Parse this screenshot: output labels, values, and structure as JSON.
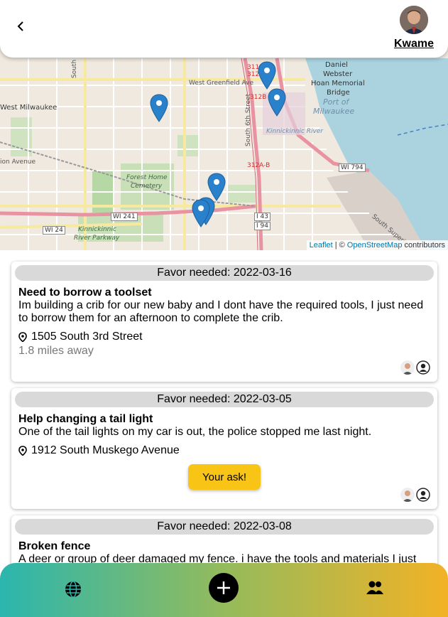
{
  "header": {
    "username": "Kwame",
    "back_icon": "chevron-left-icon",
    "avatar_icon": "user-avatar"
  },
  "map": {
    "labels": {
      "west_milwaukee": "West Milwaukee",
      "west_greenfield": "West Greenfield Ave",
      "south_35th": "South 35th Street",
      "south_6th": "South 6th Street",
      "forest_home": "Forest Home",
      "cemetery": "Cemetery",
      "kinnickinnic_parkway_1": "Kinnickinnic",
      "kinnickinnic_parkway_2": "River Parkway",
      "kinnickinnic_river": "Kinnickinnic River",
      "daniel": "Daniel",
      "webster": "Webster",
      "hoan": "Hoan Memorial",
      "bridge": "Bridge",
      "port_of": "Port of",
      "milwaukee": "Milwaukee",
      "south_superior": "South Superior Street",
      "hwy_wi794": "WI 794",
      "hwy_wi241": "WI 241",
      "hwy_wi24": "WI 24",
      "hwy_i43": "I 43",
      "hwy_i94": "I 94",
      "exit_311": "311",
      "exit_312": "312",
      "exit_312b": "312B",
      "exit_312ab": "312A-B",
      "ion_avenue": "ion Avenue"
    },
    "attribution": {
      "leaflet": "Leaflet",
      "sep": "| ©",
      "osm": "OpenStreetMap",
      "contributors": "contributors"
    },
    "marker_icon": "map-pin-icon"
  },
  "cards": [
    {
      "date": "Favor needed: 2022-03-16",
      "title": "Need to borrow a toolset",
      "description": "Im building a crib for our new baby and I dont have the required tools, I just need to borrow them for an afternoon to complete the crib.",
      "address": "1505 South 3rd Street",
      "distance": "1.8 miles away"
    },
    {
      "date": "Favor needed: 2022-03-05",
      "title": "Help changing a tail light",
      "description": "One of the tail lights on my car is out, the police stopped me last night.",
      "address": "1912 South Muskego Avenue",
      "button": "Your ask!"
    },
    {
      "date": "Favor needed: 2022-03-08",
      "title": "Broken fence",
      "description": "A deer or group of deer damaged my fence. i have the tools and materials I just"
    }
  ],
  "nav": {
    "explore_icon": "globe-icon",
    "add_icon": "plus-icon",
    "people_icon": "people-icon"
  },
  "colors": {
    "button_yellow": "#f8c416",
    "nav_gradient_start": "#2bb6ae",
    "nav_gradient_end": "#f2b226",
    "marker_blue": "#2a81cb"
  }
}
